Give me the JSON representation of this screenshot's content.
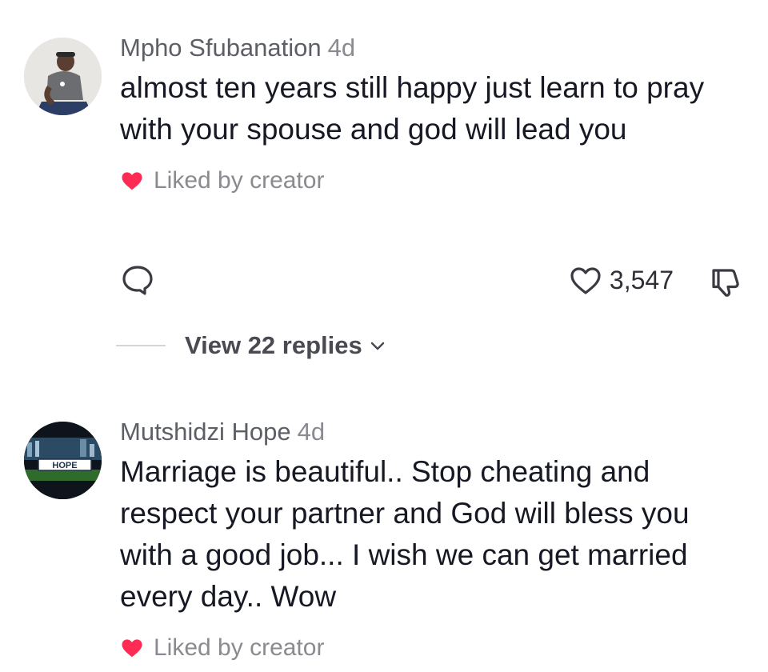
{
  "comments": [
    {
      "username": "Mpho Sfubanation",
      "time": "4d",
      "text": "almost ten years still happy just learn to pray with your spouse and god will lead you",
      "liked_label": "Liked by creator",
      "like_count": "3,547",
      "view_replies": "View 22 replies",
      "avatar_icon": "profile-photo-man-sitting"
    },
    {
      "username": "Mutshidzi Hope",
      "time": "4d",
      "text": "Marriage is beautiful.. Stop cheating and respect your partner and God will bless you with a good job... I wish we can get married every day.. Wow",
      "liked_label": "Liked by creator",
      "avatar_text": "HOPE",
      "avatar_icon": "profile-photo-hope-sign"
    }
  ],
  "colors": {
    "heart_red": "#fe2c55",
    "muted_text": "#8a8b91",
    "primary_text": "#161823"
  }
}
